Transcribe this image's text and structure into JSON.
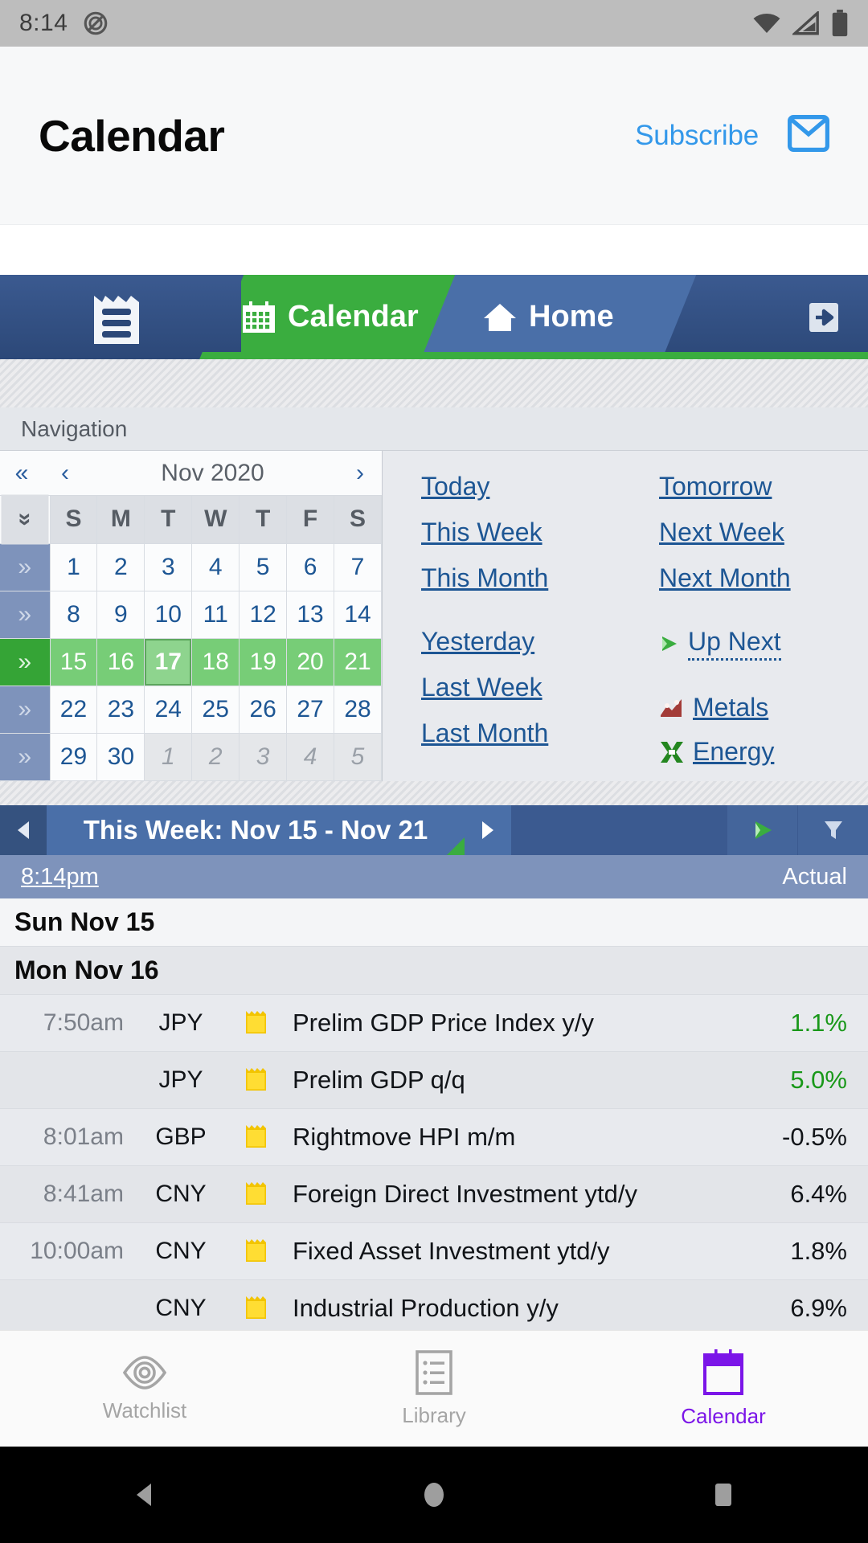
{
  "status_bar": {
    "time": "8:14",
    "icons": [
      "do-not-disturb-icon",
      "wifi-icon",
      "cellular-signal-icon",
      "battery-icon"
    ]
  },
  "app_header": {
    "title": "Calendar",
    "subscribe_label": "Subscribe",
    "mail_icon": "envelope-icon"
  },
  "web_tabbar": {
    "logo_icon": "factory-ledger-icon",
    "tabs": [
      {
        "label": "Calendar",
        "icon": "calendar-grid-icon",
        "active": true
      },
      {
        "label": "Home",
        "icon": "home-icon",
        "active": false
      }
    ],
    "exit_icon": "exit-arrow-icon"
  },
  "navigation": {
    "title": "Navigation",
    "calendar": {
      "prev_year_label": "«",
      "prev_month_label": "‹",
      "month_label": "Nov 2020",
      "next_month_label": "›",
      "weekday_headers": [
        "S",
        "M",
        "T",
        "W",
        "T",
        "F",
        "S"
      ],
      "row_head_symbol": "»",
      "corner_symbol": "»",
      "weeks": [
        {
          "selected": false,
          "days": [
            {
              "n": "1",
              "type": "day"
            },
            {
              "n": "2",
              "type": "day"
            },
            {
              "n": "3",
              "type": "day"
            },
            {
              "n": "4",
              "type": "day"
            },
            {
              "n": "5",
              "type": "day"
            },
            {
              "n": "6",
              "type": "day"
            },
            {
              "n": "7",
              "type": "day"
            }
          ]
        },
        {
          "selected": false,
          "days": [
            {
              "n": "8",
              "type": "day"
            },
            {
              "n": "9",
              "type": "day"
            },
            {
              "n": "10",
              "type": "day"
            },
            {
              "n": "11",
              "type": "day"
            },
            {
              "n": "12",
              "type": "day"
            },
            {
              "n": "13",
              "type": "day"
            },
            {
              "n": "14",
              "type": "day"
            }
          ]
        },
        {
          "selected": true,
          "days": [
            {
              "n": "15",
              "type": "week-sel"
            },
            {
              "n": "16",
              "type": "week-sel"
            },
            {
              "n": "17",
              "type": "today"
            },
            {
              "n": "18",
              "type": "week-sel"
            },
            {
              "n": "19",
              "type": "week-sel"
            },
            {
              "n": "20",
              "type": "week-sel"
            },
            {
              "n": "21",
              "type": "week-sel"
            }
          ]
        },
        {
          "selected": false,
          "days": [
            {
              "n": "22",
              "type": "day"
            },
            {
              "n": "23",
              "type": "day"
            },
            {
              "n": "24",
              "type": "day"
            },
            {
              "n": "25",
              "type": "day"
            },
            {
              "n": "26",
              "type": "day"
            },
            {
              "n": "27",
              "type": "day"
            },
            {
              "n": "28",
              "type": "day"
            }
          ]
        },
        {
          "selected": false,
          "days": [
            {
              "n": "29",
              "type": "day"
            },
            {
              "n": "30",
              "type": "day"
            },
            {
              "n": "1",
              "type": "other"
            },
            {
              "n": "2",
              "type": "other"
            },
            {
              "n": "3",
              "type": "other"
            },
            {
              "n": "4",
              "type": "other"
            },
            {
              "n": "5",
              "type": "other"
            }
          ]
        }
      ]
    },
    "quick_links_left": [
      "Today",
      "This Week",
      "This Month",
      "Yesterday",
      "Last Week",
      "Last Month"
    ],
    "quick_links_right": [
      "Tomorrow",
      "Next Week",
      "Next Month"
    ],
    "special_links": [
      {
        "label": "Up Next",
        "icon": "green-play-icon"
      },
      {
        "label": "Metals",
        "icon": "metals-chart-icon"
      },
      {
        "label": "Energy",
        "icon": "energy-x-icon"
      }
    ]
  },
  "week_bar": {
    "prev_icon": "triangle-left-icon",
    "title": "This Week: Nov 15 - Nov 21",
    "next_icon": "triangle-right-icon",
    "play_icon": "green-play-icon",
    "filter_icon": "funnel-filter-icon",
    "current_time": "8:14pm",
    "actual_header": "Actual"
  },
  "events": [
    {
      "kind": "day",
      "label": "Sun Nov 15",
      "shade": "light"
    },
    {
      "kind": "day",
      "label": "Mon Nov 16",
      "shade": "dim"
    },
    {
      "kind": "event",
      "time": "7:50am",
      "currency": "JPY",
      "impact": "yellow-folder-icon",
      "title": "Prelim GDP Price Index y/y",
      "actual": "1.1%",
      "actual_color": "up",
      "alt": false
    },
    {
      "kind": "event",
      "time": "",
      "currency": "JPY",
      "impact": "yellow-folder-icon",
      "title": "Prelim GDP q/q",
      "actual": "5.0%",
      "actual_color": "up",
      "alt": true
    },
    {
      "kind": "event",
      "time": "8:01am",
      "currency": "GBP",
      "impact": "yellow-folder-icon",
      "title": "Rightmove HPI m/m",
      "actual": "-0.5%",
      "actual_color": "neutral",
      "alt": false
    },
    {
      "kind": "event",
      "time": "8:41am",
      "currency": "CNY",
      "impact": "yellow-folder-icon",
      "title": "Foreign Direct Investment ytd/y",
      "actual": "6.4%",
      "actual_color": "neutral",
      "alt": true
    },
    {
      "kind": "event",
      "time": "10:00am",
      "currency": "CNY",
      "impact": "yellow-folder-icon",
      "title": "Fixed Asset Investment ytd/y",
      "actual": "1.8%",
      "actual_color": "neutral",
      "alt": false
    },
    {
      "kind": "event",
      "time": "",
      "currency": "CNY",
      "impact": "yellow-folder-icon",
      "title": "Industrial Production y/y",
      "actual": "6.9%",
      "actual_color": "neutral",
      "alt": true
    }
  ],
  "bottom_nav": {
    "items": [
      {
        "label": "Watchlist",
        "icon": "eye-icon",
        "active": false
      },
      {
        "label": "Library",
        "icon": "list-icon",
        "active": false
      },
      {
        "label": "Calendar",
        "icon": "calendar-icon",
        "active": true
      }
    ],
    "active_color": "#7b15e8",
    "inactive_color": "#a5a5a5"
  },
  "android_nav": {
    "back_icon": "triangle-back-icon",
    "home_icon": "circle-home-icon",
    "recents_icon": "square-recents-icon"
  }
}
